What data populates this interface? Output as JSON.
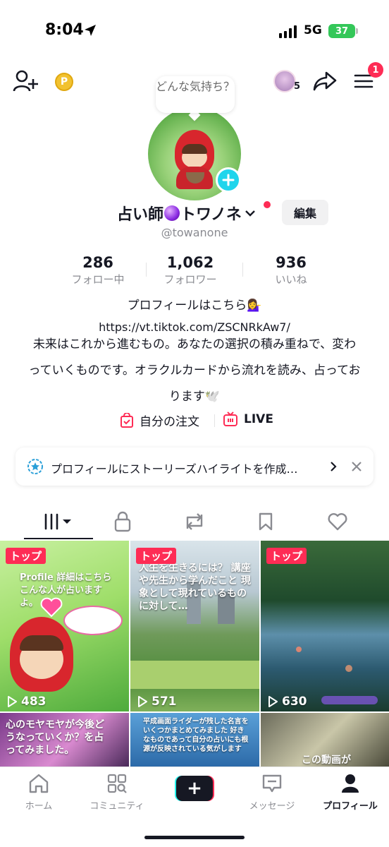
{
  "status_bar": {
    "time": "8:04",
    "network": "5G",
    "battery": "37"
  },
  "header": {
    "coin_label": "P",
    "viewer_count": "5",
    "notification_count": "1"
  },
  "profile": {
    "prompt_bubble": "どんな気持ち？",
    "name_part1": "占い師",
    "name_part2": "トワノネ",
    "edit_label": "編集",
    "username": "@towanone"
  },
  "stats": [
    {
      "value": "286",
      "label": "フォロー中"
    },
    {
      "value": "1,062",
      "label": "フォロワー"
    },
    {
      "value": "936",
      "label": "いいね"
    }
  ],
  "bio": {
    "line1": "プロフィールはこちら💁‍♀️",
    "link": "https://vt.tiktok.com/ZSCNRkAw7/",
    "text": "未来はこれから進むもの。あなたの選択の積み重ねで、変わっていくものです。オラクルカードから流れを読み、占っております🕊️"
  },
  "actions": {
    "order_label": "自分の注文",
    "live_label": "LIVE"
  },
  "story_banner": {
    "text": "プロフィールにストーリーズハイライトを作成…"
  },
  "videos": [
    {
      "badge": "トップ",
      "views": "483",
      "caption": "Profile 詳細はこちら こんな人が占いますよ。"
    },
    {
      "badge": "トップ",
      "views": "571",
      "caption": "人生を生きるには？ 講座や先生から学んだこと 現象として現れているものに対して…"
    },
    {
      "badge": "トップ",
      "views": "630",
      "caption": ""
    },
    {
      "badge": "",
      "views": "",
      "caption": "心のモヤモヤが今後どうなっていくか？を占ってみました。"
    },
    {
      "badge": "",
      "views": "",
      "caption": "平成画面ライダーが残した名言をいくつかまとめてみました 好きなものであって自分の占いにも根源が反映されている気がします"
    },
    {
      "badge": "",
      "views": "",
      "caption": "この動画が"
    }
  ],
  "bottom_nav": {
    "home": "ホーム",
    "community": "コミュニティ",
    "inbox": "メッセージ",
    "profile": "プロフィール"
  },
  "colors": {
    "accent": "#fe2c55",
    "cyan": "#25f4ee",
    "text": "#161823",
    "muted": "#8a8b91"
  }
}
